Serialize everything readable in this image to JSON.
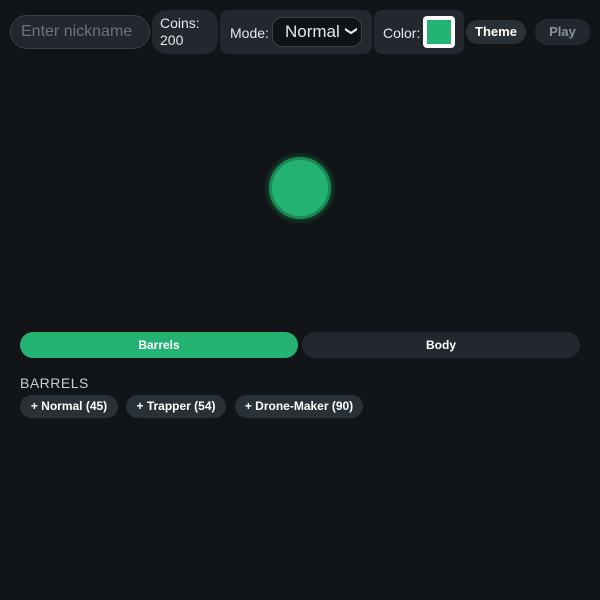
{
  "header": {
    "nickname_placeholder": "Enter nickname",
    "nickname_value": "",
    "coins_label": "Coins:",
    "coins_value": "200",
    "mode_label": "Mode:",
    "mode_selected": "Normal",
    "color_label": "Color:",
    "selected_color": "#24b373",
    "theme_label": "Theme",
    "play_label": "Play"
  },
  "tabs": [
    {
      "label": "Barrels",
      "active": true
    },
    {
      "label": "Body",
      "active": false
    }
  ],
  "section": {
    "title": "BARRELS",
    "items": [
      {
        "label": "+ Normal (45)"
      },
      {
        "label": "+ Trapper (54)"
      },
      {
        "label": "+ Drone-Maker (90)"
      }
    ]
  },
  "colors": {
    "accent": "#24b373",
    "background": "#121517",
    "surface": "#22282d"
  }
}
